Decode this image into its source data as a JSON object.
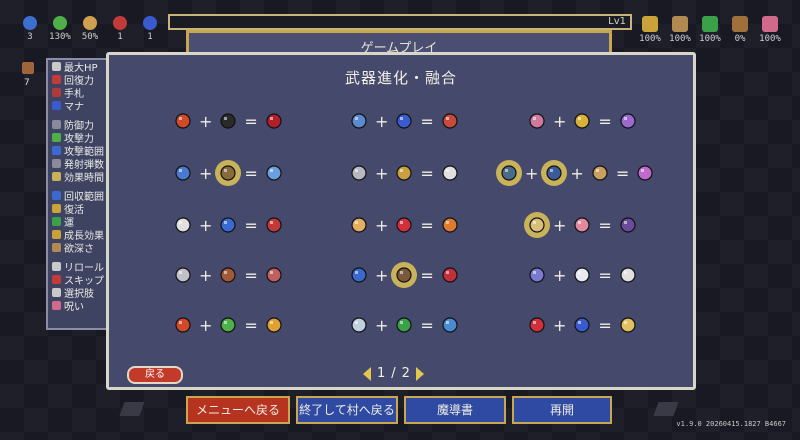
{
  "top_left_stats": [
    {
      "icon": "cycle-icon",
      "value": "3",
      "color": "#3b6fd0"
    },
    {
      "icon": "leaf-icon",
      "value": "130%",
      "color": "#4fb04a"
    },
    {
      "icon": "arrows-icon",
      "value": "50%",
      "color": "#d0a050"
    },
    {
      "icon": "heart-icon",
      "value": "1",
      "color": "#c33a3a"
    },
    {
      "icon": "orb-icon",
      "value": "1",
      "color": "#3a5ad0"
    }
  ],
  "top_right_stats": [
    {
      "icon": "crown-icon",
      "value": "100%",
      "color": "#c9a23a"
    },
    {
      "icon": "skull-gold-icon",
      "value": "100%",
      "color": "#b08a50"
    },
    {
      "icon": "clover-icon",
      "value": "100%",
      "color": "#3aa04a"
    },
    {
      "icon": "chest-icon",
      "value": "0%",
      "color": "#a0703a"
    },
    {
      "icon": "skull-pink-icon",
      "value": "100%",
      "color": "#d06a8a"
    }
  ],
  "level_label": "Lv1",
  "side_left_value": "7",
  "background_window_title": "ゲームプレイ",
  "side_stats": [
    {
      "label": "最大HP",
      "color": "#c9c9c9"
    },
    {
      "label": "回復力",
      "color": "#c33a3a"
    },
    {
      "label": "手札",
      "color": "#b03a3a"
    },
    {
      "label": "マナ",
      "color": "#3a5ad0"
    },
    {
      "label": "",
      "color": ""
    },
    {
      "label": "防御力",
      "color": "#8a8a9a"
    },
    {
      "label": "攻撃力",
      "color": "#4fb04a"
    },
    {
      "label": "攻撃範囲",
      "color": "#3a6ad0"
    },
    {
      "label": "発射弾数",
      "color": "#8a8a9a"
    },
    {
      "label": "効果時間",
      "color": "#c8b25a"
    },
    {
      "label": "",
      "color": ""
    },
    {
      "label": "回収範囲",
      "color": "#3a6ad0"
    },
    {
      "label": "復活",
      "color": "#c9a23a"
    },
    {
      "label": "運",
      "color": "#3aa04a"
    },
    {
      "label": "成長効果",
      "color": "#c9a23a"
    },
    {
      "label": "欲深さ",
      "color": "#b08a50"
    },
    {
      "label": "",
      "color": ""
    },
    {
      "label": "リロール",
      "color": "#c9c9c9"
    },
    {
      "label": "スキップ",
      "color": "#c33a3a"
    },
    {
      "label": "選択肢",
      "color": "#c9c9c9"
    },
    {
      "label": "呪い",
      "color": "#d06a8a"
    }
  ],
  "dialog": {
    "title": "武器進化・融合",
    "back_label": "戻る",
    "page_current": "1",
    "page_sep": "/",
    "page_total": "2"
  },
  "recipes": [
    {
      "a": "whip-icon",
      "b": "heart-dark-icon",
      "r": "bloody-whip-icon",
      "hl": [
        false,
        false,
        false
      ]
    },
    {
      "a": "wand-search-icon",
      "b": "orb-ring-icon",
      "r": "target-icon",
      "hl": [
        false,
        false,
        false
      ]
    },
    {
      "a": "ring-pink-icon",
      "b": "crown-icon",
      "r": "target-ring-icon",
      "hl": [
        false,
        false,
        false
      ]
    },
    {
      "a": "magic-wand-icon",
      "b": "scroll-icon",
      "r": "sparkle-wand-icon",
      "hl": [
        false,
        true,
        false
      ]
    },
    {
      "a": "axe-icon",
      "b": "candles-icon",
      "r": "scythe-icon",
      "hl": [
        false,
        false,
        false
      ]
    },
    {
      "a": "book-blade-icon",
      "b": "tome-icon",
      "r": "book-stack-icon",
      "extra": "blades-icon",
      "hl": [
        true,
        true,
        false
      ]
    },
    {
      "a": "cross-icon",
      "b": "bird-icon",
      "r": "diamond-cross-icon",
      "hl": [
        false,
        false,
        false
      ]
    },
    {
      "a": "garlic-icon",
      "b": "heart-icon",
      "r": "fireball-icon",
      "hl": [
        false,
        false,
        false
      ]
    },
    {
      "a": "map-icon",
      "b": "skull-icon",
      "r": "magic-bag-icon",
      "hl": [
        true,
        false,
        false
      ]
    },
    {
      "a": "dagger-icon",
      "b": "glove-icon",
      "r": "triple-dagger-icon",
      "hl": [
        false,
        false,
        false
      ]
    },
    {
      "a": "card-icon",
      "b": "chest-icon",
      "r": "red-book-icon",
      "hl": [
        false,
        true,
        false
      ]
    },
    {
      "a": "spiral-icon",
      "b": "wings-icon",
      "r": "bone-icon",
      "hl": [
        false,
        false,
        false
      ]
    },
    {
      "a": "fire-wand-icon",
      "b": "leaf-icon",
      "r": "flame-skull-icon",
      "hl": [
        false,
        false,
        false
      ]
    },
    {
      "a": "swords-icon",
      "b": "clover-icon",
      "r": "blue-sword-icon",
      "hl": [
        false,
        false,
        false
      ]
    },
    {
      "a": "potion-red-icon",
      "b": "orb-icon",
      "r": "potion-gold-icon",
      "hl": [
        false,
        false,
        false
      ]
    }
  ],
  "bottom_buttons": {
    "menu": "メニューへ戻る",
    "quit_village": "終了して村へ戻る",
    "grimoire": "魔導書",
    "resume": "再開"
  },
  "version": "v1.9.0 20260415.1827 B4667"
}
